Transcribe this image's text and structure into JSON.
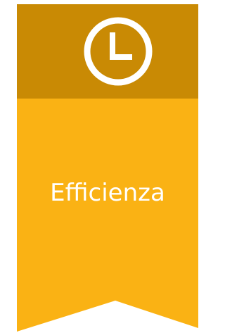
{
  "banner": {
    "label": "Efficienza",
    "icon": "clock-icon",
    "colors": {
      "header": "#c98a04",
      "body": "#fab214",
      "icon": "#ffffff",
      "label": "#ffffff"
    }
  }
}
